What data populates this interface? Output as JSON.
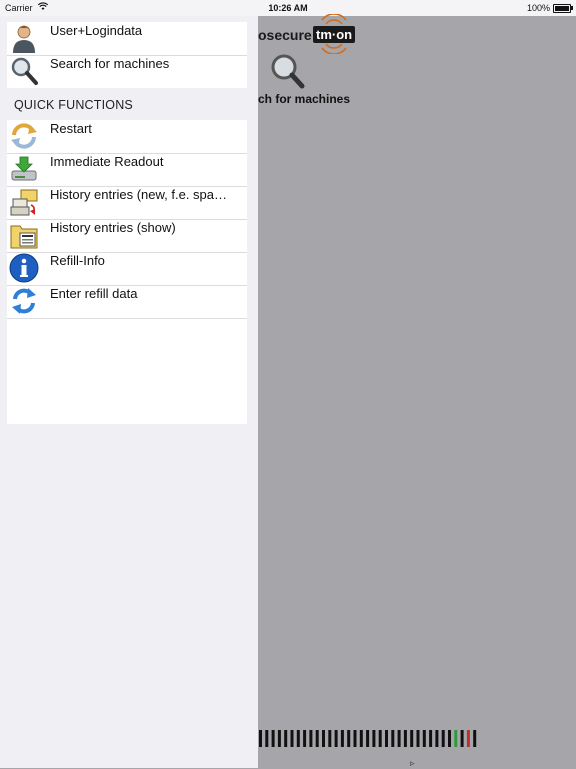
{
  "status_bar": {
    "carrier": "Carrier",
    "time": "10:26 AM",
    "battery": "100%"
  },
  "background": {
    "brand_text": "osecure",
    "brand_badge": "tm·on",
    "search_label": "ch for machines"
  },
  "drawer": {
    "top_items": [
      {
        "label": "User+Logindata",
        "icon": "user-icon"
      },
      {
        "label": "Search for machines",
        "icon": "magnifier-icon"
      }
    ],
    "section_title": "QUICK FUNCTIONS",
    "quick_items": [
      {
        "label": "Restart",
        "icon": "refresh-icon"
      },
      {
        "label": "Immediate Readout",
        "icon": "download-readout-icon"
      },
      {
        "label": "History entries (new, f.e. spa…",
        "icon": "history-new-icon"
      },
      {
        "label": "History entries (show)",
        "icon": "history-show-icon"
      },
      {
        "label": "Refill-Info",
        "icon": "info-icon"
      },
      {
        "label": "Enter refill data",
        "icon": "refill-sync-icon"
      }
    ]
  }
}
